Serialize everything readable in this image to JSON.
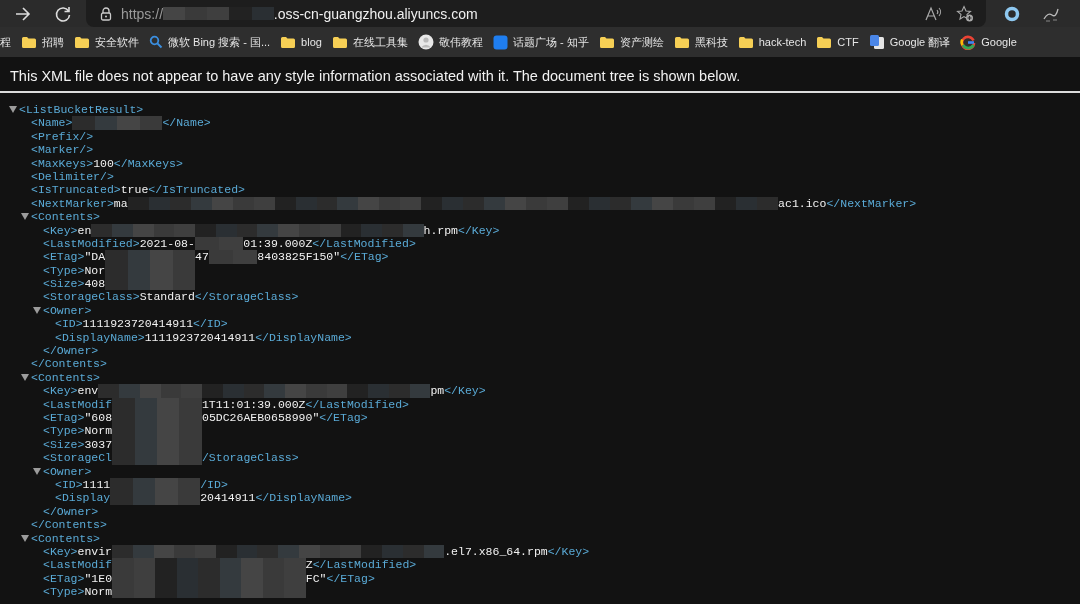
{
  "toolbar": {
    "url": {
      "scheme": "https://",
      "host": ".oss-cn-guangzhou.aliyuncs.com"
    }
  },
  "bookmarks": [
    {
      "kind": "none",
      "label": "程"
    },
    {
      "kind": "folder",
      "label": "招聘"
    },
    {
      "kind": "folder",
      "label": "安全软件"
    },
    {
      "kind": "search",
      "label": "微软 Bing 搜索 - 国..."
    },
    {
      "kind": "folder",
      "label": "blog"
    },
    {
      "kind": "folder",
      "label": "在线工具集"
    },
    {
      "kind": "avatar",
      "label": "敬伟教程"
    },
    {
      "kind": "square",
      "label": "话题广场 - 知乎"
    },
    {
      "kind": "folder",
      "label": "资产测绘"
    },
    {
      "kind": "folder",
      "label": "黑科技"
    },
    {
      "kind": "folder",
      "label": "hack-tech"
    },
    {
      "kind": "folder",
      "label": "CTF"
    },
    {
      "kind": "translate",
      "label": "Google 翻译"
    },
    {
      "kind": "google",
      "label": "Google"
    }
  ],
  "notice": "This XML file does not appear to have any style information associated with it. The document tree is shown below.",
  "tree": {
    "open": "<ListBucketResult>",
    "expanded": true,
    "children": [
      {
        "parts": [
          {
            "kind": "tag",
            "text": "<Name>"
          },
          {
            "kind": "mask"
          },
          {
            "kind": "tag",
            "text": "</Name>"
          }
        ]
      },
      {
        "parts": [
          {
            "kind": "tag",
            "text": "<Prefix/>"
          }
        ]
      },
      {
        "parts": [
          {
            "kind": "tag",
            "text": "<Marker/>"
          }
        ]
      },
      {
        "parts": [
          {
            "kind": "tag",
            "text": "<MaxKeys>"
          },
          {
            "kind": "text",
            "text": "100"
          },
          {
            "kind": "tag",
            "text": "</MaxKeys>"
          }
        ]
      },
      {
        "parts": [
          {
            "kind": "tag",
            "text": "<Delimiter/>"
          }
        ]
      },
      {
        "parts": [
          {
            "kind": "tag",
            "text": "<IsTruncated>"
          },
          {
            "kind": "text",
            "text": "true"
          },
          {
            "kind": "tag",
            "text": "</IsTruncated>"
          }
        ]
      },
      {
        "parts": [
          {
            "kind": "tag",
            "text": "<NextMarker>"
          },
          {
            "kind": "text",
            "text": "ma"
          },
          {
            "kind": "fullmask"
          },
          {
            "kind": "text",
            "text": "ac1.ico"
          },
          {
            "kind": "tag",
            "text": "</NextMarker>"
          }
        ]
      },
      {
        "open": "<Contents>",
        "close": "</Contents>",
        "expanded": true,
        "children": [
          {
            "parts": [
              {
                "kind": "tag",
                "text": "<Key>"
              },
              {
                "kind": "text",
                "text": "en"
              },
              {
                "kind": "longmask"
              },
              {
                "kind": "text",
                "text": "h.rpm"
              },
              {
                "kind": "tag",
                "text": "</Key>"
              }
            ]
          },
          {
            "parts": [
              {
                "kind": "tag",
                "text": "<LastModified>"
              },
              {
                "kind": "text",
                "text": "2021-08-"
              },
              {
                "kind": "smallmask"
              },
              {
                "kind": "text",
                "text": "01:39.000Z"
              },
              {
                "kind": "tag",
                "text": "</LastModified>"
              }
            ]
          },
          {
            "parts": [
              {
                "kind": "tag",
                "text": "<ETag>"
              },
              {
                "kind": "text",
                "text": "\"DA"
              },
              {
                "kind": "mask"
              },
              {
                "kind": "text",
                "text": "47"
              },
              {
                "kind": "smallmask"
              },
              {
                "kind": "text",
                "text": "8403825F150\""
              },
              {
                "kind": "tag",
                "text": "</ETag>"
              }
            ]
          },
          {
            "parts": [
              {
                "kind": "tag",
                "text": "<Type>"
              },
              {
                "kind": "text",
                "text": "Nor"
              },
              {
                "kind": "mask"
              }
            ]
          },
          {
            "parts": [
              {
                "kind": "tag",
                "text": "<Size>"
              },
              {
                "kind": "text",
                "text": "408"
              },
              {
                "kind": "mask"
              }
            ]
          },
          {
            "parts": [
              {
                "kind": "tag",
                "text": "<StorageClass>"
              },
              {
                "kind": "text",
                "text": "Standard"
              },
              {
                "kind": "tag",
                "text": "</StorageClass>"
              }
            ]
          },
          {
            "open": "<Owner>",
            "close": "</Owner>",
            "expanded": true,
            "children": [
              {
                "parts": [
                  {
                    "kind": "tag",
                    "text": "<ID>"
                  },
                  {
                    "kind": "text",
                    "text": "1111923720414911"
                  },
                  {
                    "kind": "tag",
                    "text": "</ID>"
                  }
                ]
              },
              {
                "parts": [
                  {
                    "kind": "tag",
                    "text": "<DisplayName>"
                  },
                  {
                    "kind": "text",
                    "text": "1111923720414911"
                  },
                  {
                    "kind": "tag",
                    "text": "</DisplayName>"
                  }
                ]
              }
            ]
          }
        ]
      },
      {
        "open": "<Contents>",
        "close": "</Contents>",
        "expanded": true,
        "children": [
          {
            "parts": [
              {
                "kind": "tag",
                "text": "<Key>"
              },
              {
                "kind": "text",
                "text": "env"
              },
              {
                "kind": "longmask"
              },
              {
                "kind": "text",
                "text": "pm"
              },
              {
                "kind": "tag",
                "text": "</Key>"
              }
            ]
          },
          {
            "parts": [
              {
                "kind": "tag",
                "text": "<LastModif"
              },
              {
                "kind": "mask"
              },
              {
                "kind": "text",
                "text": "1T11:01:39.000Z"
              },
              {
                "kind": "tag",
                "text": "</LastModified>"
              }
            ]
          },
          {
            "parts": [
              {
                "kind": "tag",
                "text": "<ETag>"
              },
              {
                "kind": "text",
                "text": "\"608"
              },
              {
                "kind": "mask"
              },
              {
                "kind": "text",
                "text": "05DC26AEB0658990\""
              },
              {
                "kind": "tag",
                "text": "</ETag>"
              }
            ]
          },
          {
            "parts": [
              {
                "kind": "tag",
                "text": "<Type>"
              },
              {
                "kind": "text",
                "text": "Norm"
              },
              {
                "kind": "mask"
              }
            ]
          },
          {
            "parts": [
              {
                "kind": "tag",
                "text": "<Size>"
              },
              {
                "kind": "text",
                "text": "3037"
              },
              {
                "kind": "mask"
              }
            ]
          },
          {
            "parts": [
              {
                "kind": "tag",
                "text": "<StorageCl"
              },
              {
                "kind": "mask"
              },
              {
                "kind": "tag",
                "text": "/StorageClass>"
              }
            ]
          },
          {
            "open": "<Owner>",
            "close": "</Owner>",
            "expanded": true,
            "children": [
              {
                "parts": [
                  {
                    "kind": "tag",
                    "text": "<ID>"
                  },
                  {
                    "kind": "text",
                    "text": "1111"
                  },
                  {
                    "kind": "mask"
                  },
                  {
                    "kind": "tag",
                    "text": "/ID>"
                  }
                ]
              },
              {
                "parts": [
                  {
                    "kind": "tag",
                    "text": "<Display"
                  },
                  {
                    "kind": "mask"
                  },
                  {
                    "kind": "text",
                    "text": "20414911"
                  },
                  {
                    "kind": "tag",
                    "text": "</DisplayName>"
                  }
                ]
              }
            ]
          }
        ]
      },
      {
        "open": "<Contents>",
        "expanded": true,
        "children": [
          {
            "parts": [
              {
                "kind": "tag",
                "text": "<Key>"
              },
              {
                "kind": "text",
                "text": "envir"
              },
              {
                "kind": "longmask"
              },
              {
                "kind": "text",
                "text": ".el7.x86_64.rpm"
              },
              {
                "kind": "tag",
                "text": "</Key>"
              }
            ]
          },
          {
            "parts": [
              {
                "kind": "tag",
                "text": "<LastModif"
              },
              {
                "kind": "widemask"
              },
              {
                "kind": "text",
                "text": "Z"
              },
              {
                "kind": "tag",
                "text": "</LastModified>"
              }
            ]
          },
          {
            "parts": [
              {
                "kind": "tag",
                "text": "<ETag>"
              },
              {
                "kind": "text",
                "text": "\"1E0"
              },
              {
                "kind": "widemask"
              },
              {
                "kind": "text",
                "text": "FC\""
              },
              {
                "kind": "tag",
                "text": "</ETag>"
              }
            ]
          },
          {
            "parts": [
              {
                "kind": "tag",
                "text": "<Type>"
              },
              {
                "kind": "text",
                "text": "Norm"
              },
              {
                "kind": "widemask"
              }
            ]
          }
        ]
      }
    ]
  }
}
